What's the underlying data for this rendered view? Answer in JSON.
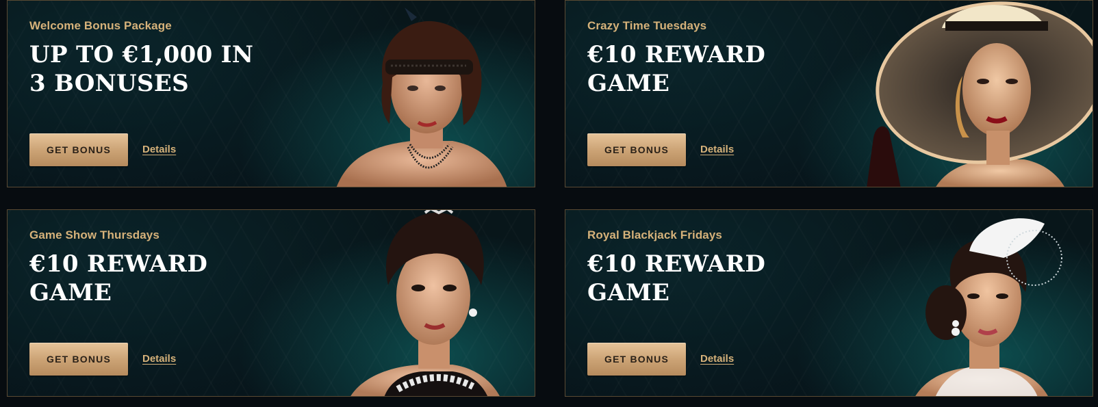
{
  "cards": [
    {
      "subtitle": "Welcome Bonus Package",
      "headline_line1": "UP TO €1,000 IN",
      "headline_line2": "3 BONUSES",
      "button_label": "GET BONUS",
      "details_label": "Details",
      "portrait_name": "flapper-woman-portrait"
    },
    {
      "subtitle": "Crazy Time Tuesdays",
      "headline_line1": "€10 REWARD",
      "headline_line2": "GAME",
      "button_label": "GET BONUS",
      "details_label": "Details",
      "portrait_name": "woman-wide-hat-portrait"
    },
    {
      "subtitle": "Game Show Thursdays",
      "headline_line1": "€10 REWARD",
      "headline_line2": "GAME",
      "button_label": "GET BONUS",
      "details_label": "Details",
      "portrait_name": "woman-updo-portrait"
    },
    {
      "subtitle": "Royal Blackjack Fridays",
      "headline_line1": "€10 REWARD",
      "headline_line2": "GAME",
      "button_label": "GET BONUS",
      "details_label": "Details",
      "portrait_name": "woman-feather-hat-portrait"
    }
  ],
  "colors": {
    "gold_text": "#d6b27a",
    "button_gold": "#caa173",
    "background": "#070c10",
    "teal_glow": "#127876"
  }
}
